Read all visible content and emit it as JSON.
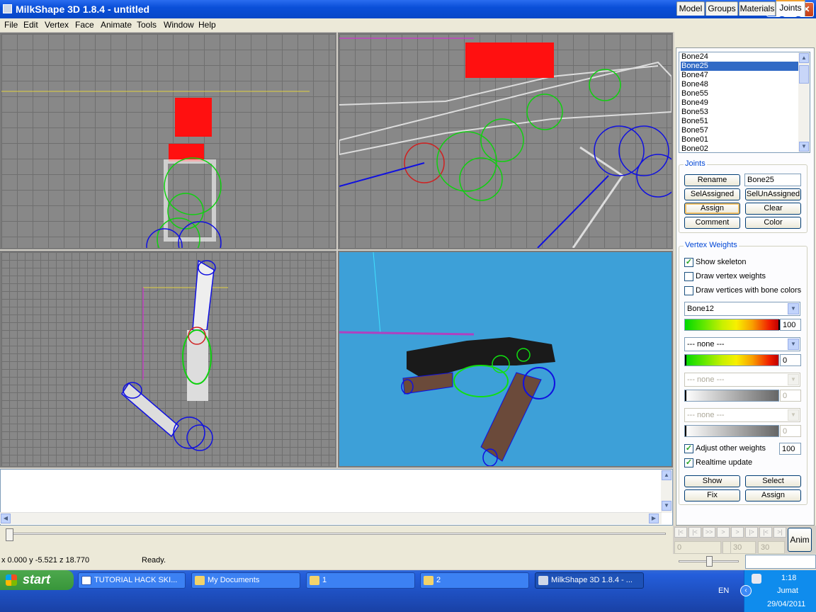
{
  "window": {
    "title": "MilkShape 3D 1.8.4 - untitled",
    "min": "_",
    "max": "□",
    "close": "✕"
  },
  "menu": [
    "File",
    "Edit",
    "Vertex",
    "Face",
    "Animate",
    "Tools",
    "Window",
    "Help"
  ],
  "tabs": [
    "Model",
    "Groups",
    "Materials",
    "Joints"
  ],
  "bones": [
    "Bone24",
    "Bone25",
    "Bone47",
    "Bone48",
    "Bone55",
    "Bone49",
    "Bone53",
    "Bone51",
    "Bone57",
    "Bone01",
    "Bone02"
  ],
  "joints": {
    "label": "Joints",
    "rename": "Rename",
    "name_value": "Bone25",
    "sel_assigned": "SelAssigned",
    "sel_unassigned": "SelUnAssigned",
    "assign": "Assign",
    "clear": "Clear",
    "comment": "Comment",
    "color": "Color"
  },
  "vertex_weights": {
    "label": "Vertex Weights",
    "show_skeleton": "Show skeleton",
    "draw_vertex_weights": "Draw vertex weights",
    "draw_bone_colors": "Draw vertices with bone colors",
    "bone1": "Bone12",
    "weight1": "100",
    "weight1_level": 100,
    "bone2": "--- none ---",
    "weight2": "0",
    "weight2_level": 0,
    "bone3": "--- none ---",
    "weight3": "0",
    "bone4": "--- none ---",
    "weight4": "0",
    "adjust_other": "Adjust other weights",
    "adjust_value": "100",
    "realtime": "Realtime update",
    "show": "Show",
    "select": "Select",
    "fix": "Fix",
    "assign": "Assign"
  },
  "checkbox_checked": "✓",
  "anim": {
    "button": "Anim",
    "frame": "0",
    "start": "30",
    "end": "30",
    "nav": [
      "|<",
      "|<",
      ">>",
      ">",
      ">",
      "|>",
      "|<",
      ">|"
    ]
  },
  "status": {
    "coords": "x 0.000 y -5.521 z 18.770",
    "text": "Ready."
  },
  "taskbar": {
    "start": "start",
    "tasks": [
      "TUTORIAL HACK SKI...",
      "My Documents",
      "1",
      "2",
      "MilkShape 3D 1.8.4 - ..."
    ],
    "lang": "EN"
  },
  "clock": {
    "time": "1:18",
    "day": "Jumat",
    "date": "29/04/2011"
  },
  "colors": {
    "viewport_grid": "#888888",
    "viewport_3d": "#3da0d8",
    "selected": "#ff0000",
    "bones": "#00ff00",
    "joints": "#0000ff"
  }
}
